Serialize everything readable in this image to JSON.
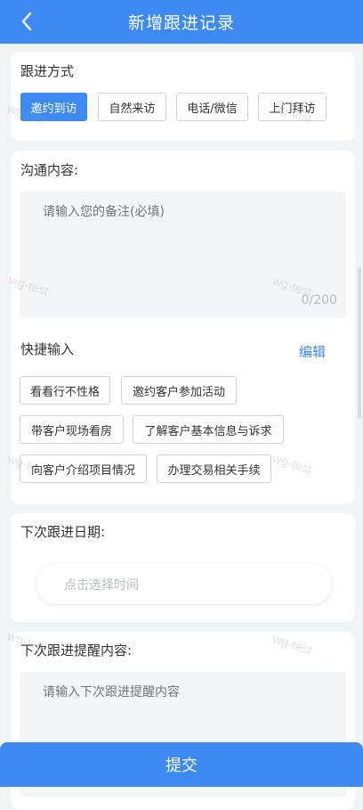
{
  "header": {
    "title": "新增跟进记录",
    "back_icon": "chevron-left-icon"
  },
  "follow_method": {
    "label": "跟进方式",
    "options": [
      "邀约到访",
      "自然来访",
      "电话/微信",
      "上门拜访"
    ],
    "selected": "邀约到访"
  },
  "communication": {
    "label": "沟通内容:",
    "placeholder": "请输入您的备注(必填)",
    "counter": "0/200"
  },
  "quick_input": {
    "label": "快捷输入",
    "edit_label": "编辑",
    "chips": [
      "看看行不性格",
      "邀约客户参加活动",
      "带客户现场看房",
      "了解客户基本信息与诉求",
      "向客户介绍项目情况",
      "办理交易相关手续"
    ]
  },
  "next_date": {
    "label": "下次跟进日期:",
    "placeholder": "点击选择时间"
  },
  "reminder": {
    "label": "下次跟进提醒内容:",
    "placeholder": "请输入下次跟进提醒内容"
  },
  "submit_label": "提交",
  "watermark": "wg-test",
  "colors": {
    "primary": "#3d8bf2",
    "background": "#f2f3f5"
  }
}
